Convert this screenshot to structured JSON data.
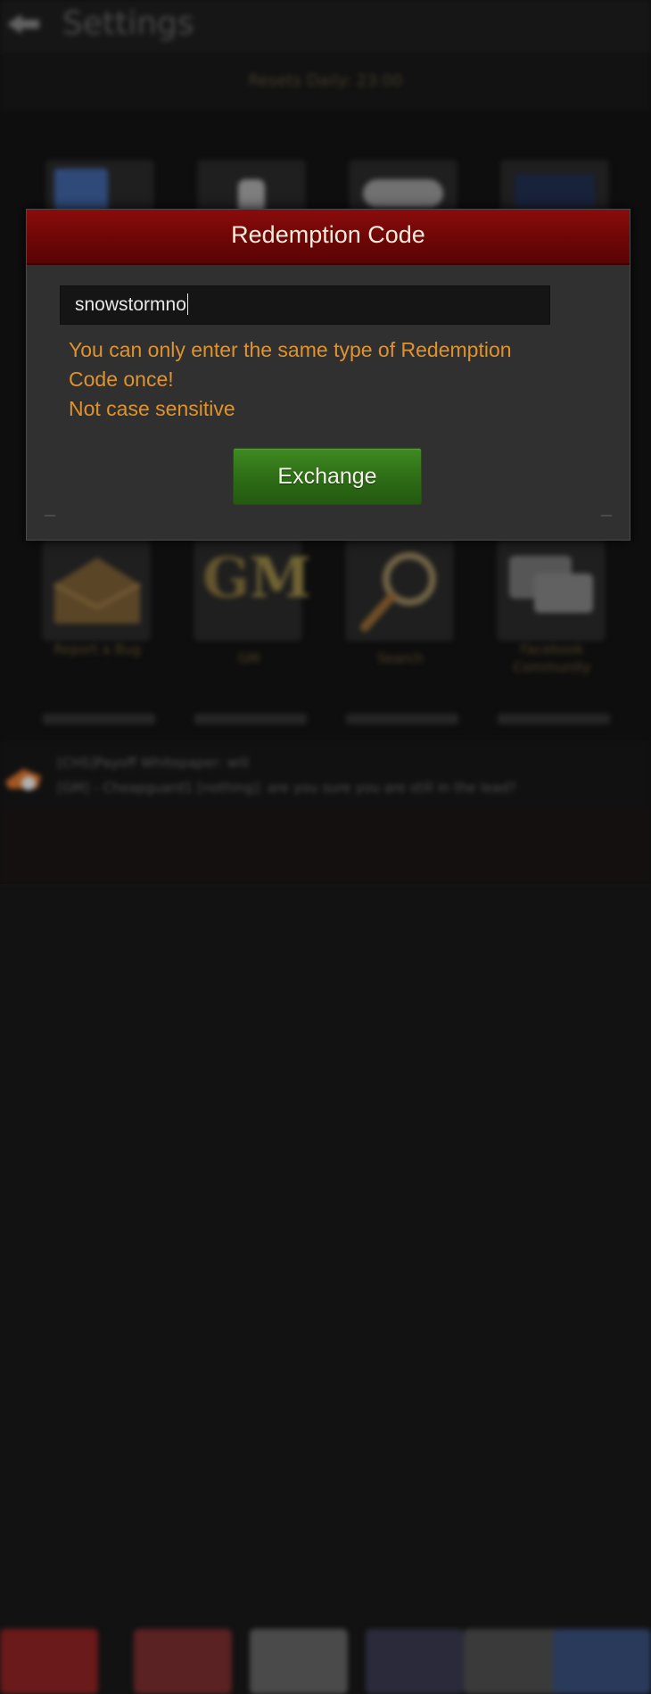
{
  "background": {
    "settings_title": "Settings",
    "reset_text": "Resets Daily: 23:00",
    "bottom_tiles": [
      {
        "label": "Report a Bug"
      },
      {
        "label": "GM"
      },
      {
        "label": "Search"
      },
      {
        "label": "Facebook Community"
      }
    ],
    "chat_notice": {
      "line1": "[CHS]Payoff Whitepaper: will",
      "line2": "[GM] - Cheapguard1 [nothing]: are you sure you are still in the lead?"
    }
  },
  "dialog": {
    "title": "Redemption Code",
    "input_value": "snowstormno",
    "notice_line1": "You can only enter the same type of Redemption",
    "notice_line2": "Code once!",
    "notice_line3": "Not case sensitive",
    "exchange_label": "Exchange"
  },
  "colors": {
    "header_red": "#7a0808",
    "notice_orange": "#e0922b",
    "button_green": "#2c6a15"
  }
}
